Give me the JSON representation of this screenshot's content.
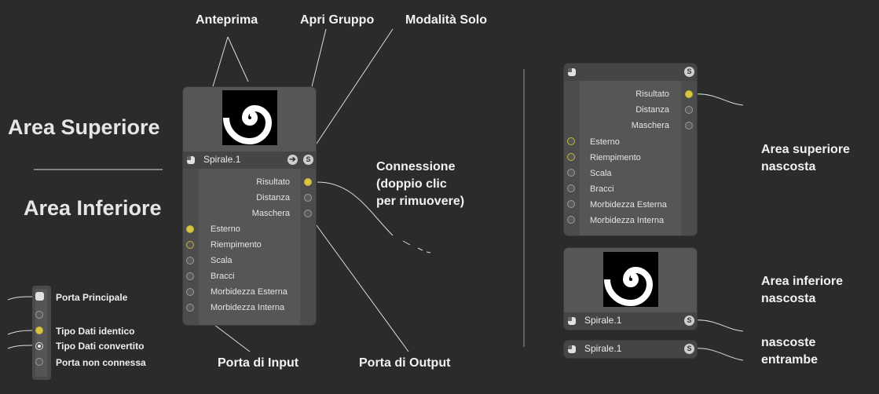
{
  "callouts": {
    "anteprima": "Anteprima",
    "apri_gruppo": "Apri Gruppo",
    "modalita_solo": "Modalità Solo",
    "connessione": [
      "Connessione",
      "(doppio clic",
      "per rimuovere)"
    ],
    "porta_input": "Porta di Input",
    "porta_output": "Porta di Output",
    "area_superiore_nascosta": [
      "Area superiore",
      "nascosta"
    ],
    "area_inferiore_nascosta": [
      "Area inferiore",
      "nascosta"
    ],
    "nascoste_entrambe": [
      "nascoste",
      "entrambe"
    ]
  },
  "headings": {
    "area_superiore": "Area Superiore",
    "area_inferiore": "Area Inferiore"
  },
  "node": {
    "title": "Spirale.1",
    "solo_icon": "S",
    "group_icon": "➔",
    "outputs": [
      "Risultato",
      "Distanza",
      "Maschera"
    ],
    "inputs": [
      "Esterno",
      "Riempimento",
      "Scala",
      "Bracci",
      "Morbidezza Esterna",
      "Morbidezza Interna"
    ]
  },
  "legend": {
    "items": [
      "Porta Principale",
      "Tipo Dati identico",
      "Tipo Dati convertito",
      "Porta non connessa"
    ]
  },
  "colors": {
    "background": "#2b2b2b",
    "node_body": "#565656",
    "port_connected": "#d9c541",
    "port_unconnected": "#9a9a9a"
  }
}
